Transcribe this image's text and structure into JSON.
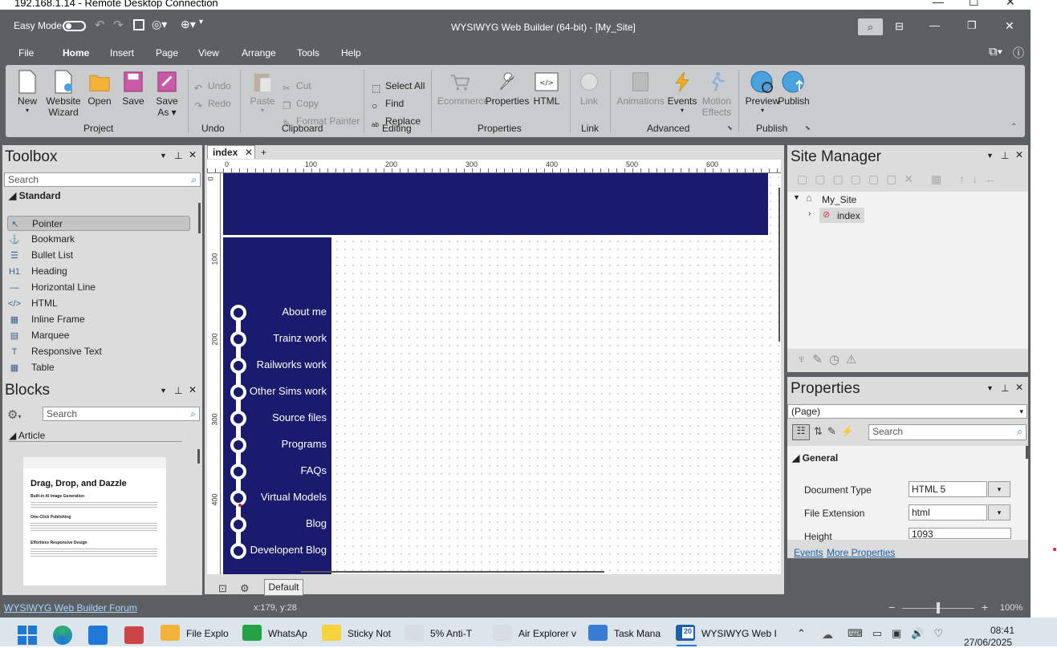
{
  "rdp": {
    "title": "192.168.1.14 - Remote Desktop Connection"
  },
  "app": {
    "title": "WYSIWYG Web Builder (64-bit) - [My_Site]",
    "easy_mode_label": "Easy Mode"
  },
  "ribbon_tabs": [
    "File",
    "Home",
    "Insert",
    "Page",
    "View",
    "Arrange",
    "Tools",
    "Help"
  ],
  "ribbon": {
    "project": {
      "label": "Project",
      "new": "New",
      "website_wizard_1": "Website",
      "website_wizard_2": "Wizard",
      "open": "Open",
      "save": "Save",
      "save_as_1": "Save",
      "save_as_2": "As"
    },
    "undo": {
      "label": "Undo",
      "undo": "Undo",
      "redo": "Redo"
    },
    "clipboard": {
      "label": "Clipboard",
      "paste": "Paste",
      "cut": "Cut",
      "copy": "Copy",
      "format_painter": "Format Painter"
    },
    "editing": {
      "label": "Editing",
      "select_all": "Select All",
      "find": "Find",
      "replace": "Replace"
    },
    "properties": {
      "label": "Properties",
      "ecommerce": "Ecommerce",
      "properties": "Properties",
      "html": "HTML"
    },
    "link": {
      "label": "Link",
      "link": "Link"
    },
    "advanced": {
      "label": "Advanced",
      "animations": "Animations",
      "events": "Events",
      "motion_1": "Motion",
      "motion_2": "Effects"
    },
    "publish": {
      "label": "Publish",
      "preview": "Preview",
      "publish": "Publish"
    }
  },
  "toolbox": {
    "title": "Toolbox",
    "search_placeholder": "Search",
    "section": "Standard",
    "items": [
      {
        "label": "Pointer",
        "icon": "↖"
      },
      {
        "label": "Bookmark",
        "icon": "⚓"
      },
      {
        "label": "Bullet List",
        "icon": "☰"
      },
      {
        "label": "Heading",
        "icon": "H1"
      },
      {
        "label": "Horizontal Line",
        "icon": "—"
      },
      {
        "label": "HTML",
        "icon": "</>"
      },
      {
        "label": "Inline Frame",
        "icon": "▦"
      },
      {
        "label": "Marquee",
        "icon": "▤"
      },
      {
        "label": "Responsive Text",
        "icon": "T"
      },
      {
        "label": "Table",
        "icon": "▦"
      }
    ]
  },
  "blocks": {
    "title": "Blocks",
    "search_placeholder": "Search",
    "section": "Article",
    "preview_heading": "Drag, Drop, and Dazzle",
    "preview_sub1": "Built-in AI Image Generation",
    "preview_sub2": "One-Click Publishing",
    "preview_sub3": "Effortless Responsive Design"
  },
  "document": {
    "tab": "index",
    "ruler_marks": [
      "0",
      "100",
      "200",
      "300",
      "400",
      "500",
      "600"
    ],
    "vruler_marks": [
      "0",
      "100",
      "200",
      "300",
      "400"
    ],
    "menu": [
      "About me",
      "Trainz work",
      "Railworks work",
      "Other Sims work",
      "Source files",
      "Programs",
      "FAQs",
      "Virtual Models",
      "Blog",
      "Developent Blog"
    ],
    "header_color": "#1a1a6e",
    "default_btn": "Default"
  },
  "site_manager": {
    "title": "Site Manager",
    "root": "My_Site",
    "page": "index"
  },
  "properties_panel": {
    "title": "Properties",
    "selector": "(Page)",
    "search_placeholder": "Search",
    "section": "General",
    "rows": [
      {
        "name": "Document Type",
        "value": "HTML 5"
      },
      {
        "name": "File Extension",
        "value": "html"
      },
      {
        "name": "Height",
        "value": "1093"
      }
    ],
    "events_link": "Events",
    "more_link": "More Properties"
  },
  "statusbar": {
    "forum_link": "WYSIWYG Web Builder Forum",
    "coords": "x:179, y:28",
    "zoom": "100%"
  },
  "taskbar": {
    "items": [
      {
        "label": "File Explo",
        "color": "#f0b43a"
      },
      {
        "label": "WhatsAp",
        "color": "#25a244"
      },
      {
        "label": "Sticky Not",
        "color": "#f5d33a"
      },
      {
        "label": "5% Anti-T",
        "color": "#d8dde3"
      },
      {
        "label": "Air Explorer v",
        "color": "#d8dde3"
      },
      {
        "label": "Task Mana",
        "color": "#3a7bd5"
      },
      {
        "label": "WYSIWYG Web I",
        "color": "#1f5fa8"
      }
    ],
    "web_builder_badge": "20",
    "time": "08:41",
    "date": "27/06/2025"
  }
}
